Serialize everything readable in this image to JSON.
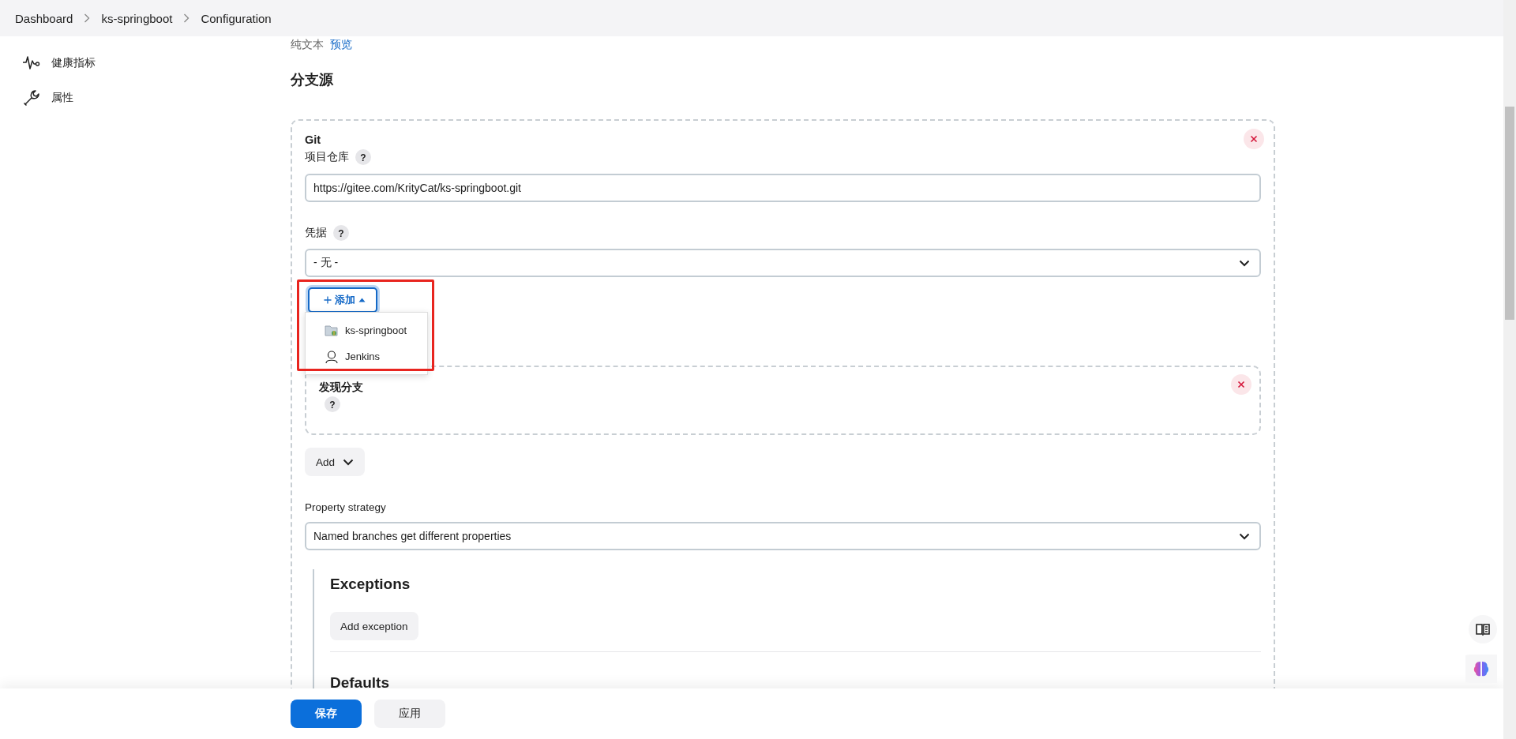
{
  "breadcrumb": [
    {
      "label": "Dashboard"
    },
    {
      "label": "ks-springboot"
    },
    {
      "label": "Configuration"
    }
  ],
  "sidebar": {
    "items": [
      {
        "label": "健康指标",
        "kind": "health"
      },
      {
        "label": "属性",
        "kind": "properties"
      }
    ]
  },
  "description_format": {
    "plain_text": "纯文本",
    "preview": "预览"
  },
  "section_title": "分支源",
  "git_source": {
    "title": "Git",
    "repository": {
      "label": "项目仓库",
      "help": "?",
      "value": "https://gitee.com/KrityCat/ks-springboot.git"
    },
    "credentials": {
      "label": "凭据",
      "help": "?",
      "value": "- 无 -"
    },
    "add_button": {
      "label": "添加",
      "expanded": true,
      "highlighted": true,
      "menu": [
        {
          "label": "ks-springboot",
          "kind": "folder"
        },
        {
          "label": "Jenkins",
          "kind": "person"
        }
      ]
    },
    "behaviors": [
      {
        "title": "发现分支",
        "help": "?"
      }
    ],
    "add_behavior": "Add",
    "property_strategy": {
      "label": "Property strategy",
      "value": "Named branches get different properties"
    },
    "exceptions": {
      "title": "Exceptions",
      "add_button": "Add exception"
    },
    "defaults": {
      "title": "Defaults"
    }
  },
  "footer": {
    "save": "保存",
    "apply": "应用"
  }
}
